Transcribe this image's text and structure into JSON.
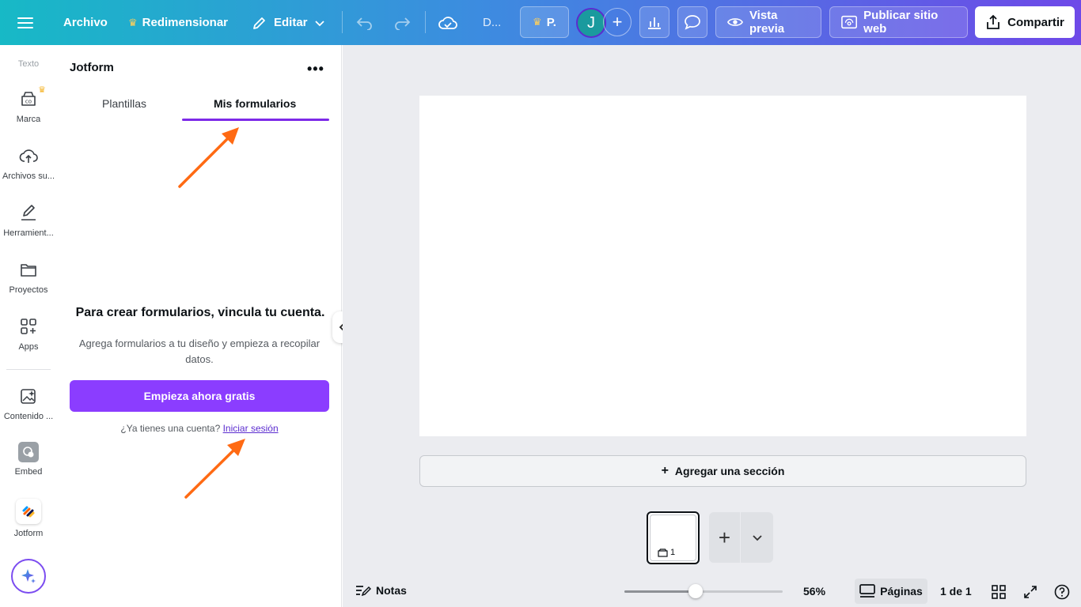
{
  "topbar": {
    "menu_icon": "hamburger-icon",
    "file_label": "Archivo",
    "resize_label": "Redimensionar",
    "edit_label": "Editar",
    "doc_title": "D...",
    "premium_label": "P.",
    "avatar_initial": "J",
    "preview_label": "Vista previa",
    "publish_label": "Publicar sitio web",
    "share_label": "Compartir"
  },
  "rail": {
    "items": [
      {
        "label": "Texto"
      },
      {
        "label": "Marca"
      },
      {
        "label": "Archivos su..."
      },
      {
        "label": "Herramient..."
      },
      {
        "label": "Proyectos"
      },
      {
        "label": "Apps"
      },
      {
        "label": "Contenido ..."
      },
      {
        "label": "Embed"
      },
      {
        "label": "Jotform"
      }
    ]
  },
  "panel": {
    "title": "Jotform",
    "tabs": [
      {
        "label": "Plantillas",
        "active": false
      },
      {
        "label": "Mis formularios",
        "active": true
      }
    ],
    "empty_title": "Para crear formularios, vincula tu cuenta.",
    "empty_desc": "Agrega formularios a tu diseño y empieza a recopilar datos.",
    "cta_label": "Empieza ahora gratis",
    "login_prompt": "¿Ya tienes una cuenta?",
    "login_link": "Iniciar sesión"
  },
  "canvas": {
    "add_section_label": "Agregar una sección",
    "thumb_number": "1"
  },
  "bottombar": {
    "notes_label": "Notas",
    "zoom_fraction": 0.45,
    "zoom_value": "56%",
    "pages_label": "Páginas",
    "page_count": "1 de 1"
  },
  "colors": {
    "accent": "#8b3dff",
    "tab_underline": "#7d2ae8",
    "annotation_arrow": "#ff6a13"
  }
}
